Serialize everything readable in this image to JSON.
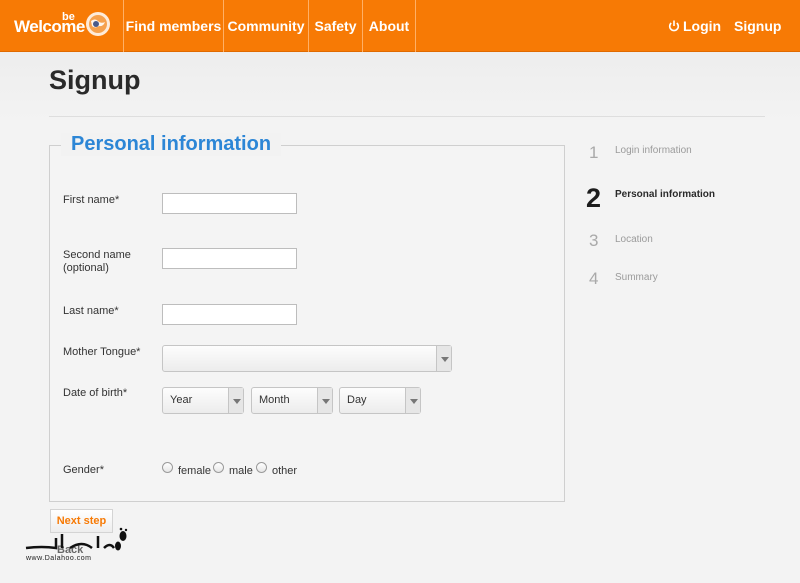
{
  "nav": {
    "logo_word": "Welcome",
    "logo_be": "be",
    "items": [
      {
        "label": "Find members"
      },
      {
        "label": "Community"
      },
      {
        "label": "Safety"
      },
      {
        "label": "About"
      }
    ],
    "login_label": "Login",
    "signup_label": "Signup"
  },
  "page": {
    "title": "Signup"
  },
  "form": {
    "legend": "Personal information",
    "first_name_label": "First name*",
    "second_name_label": "Second name\n(optional)",
    "second_name_line1": "Second name",
    "second_name_line2": "(optional)",
    "last_name_label": "Last name*",
    "mother_tongue_label": "Mother Tongue*",
    "mother_tongue_value": "",
    "dob_label": "Date of birth*",
    "dob": {
      "year": "Year",
      "month": "Month",
      "day": "Day"
    },
    "gender_label": "Gender*",
    "gender_options": [
      "female",
      "male",
      "other"
    ]
  },
  "steps": [
    {
      "num": "1",
      "label": "Login information"
    },
    {
      "num": "2",
      "label": "Personal information"
    },
    {
      "num": "3",
      "label": "Location"
    },
    {
      "num": "4",
      "label": "Summary"
    }
  ],
  "buttons": {
    "next": "Next step",
    "back": "Back"
  },
  "watermark": {
    "site": "www.Dalahoo.com"
  },
  "colors": {
    "brand_orange": "#f77a05",
    "legend_blue": "#2c86d6"
  }
}
